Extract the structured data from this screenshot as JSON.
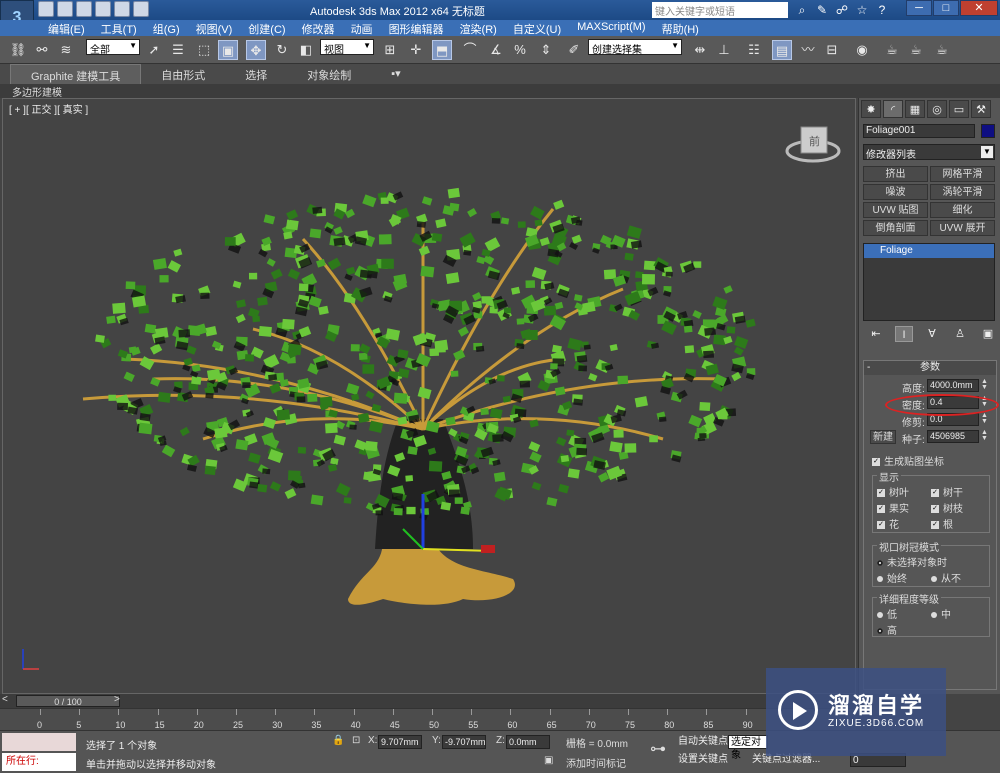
{
  "titlebar": {
    "title": "Autodesk 3ds Max  2012 x64      无标题",
    "search_placeholder": "键入关键字或短语",
    "minimize": "─",
    "maximize": "□",
    "close": "✕"
  },
  "menubar": [
    "编辑(E)",
    "工具(T)",
    "组(G)",
    "视图(V)",
    "创建(C)",
    "修改器",
    "动画",
    "图形编辑器",
    "渲染(R)",
    "自定义(U)",
    "MAXScript(M)",
    "帮助(H)"
  ],
  "toolbar": {
    "selection_filter": "全部",
    "ref_coord": "视图",
    "named_selection": "创建选择集"
  },
  "ribbon": {
    "tabs": [
      "Graphite 建模工具",
      "自由形式",
      "选择",
      "对象绘制"
    ],
    "active_tab": "Graphite 建模工具",
    "sub_label": "多边形建模"
  },
  "viewport": {
    "label": "[ + ][ 正交 ][ 真实 ]",
    "viewcube_label": "前"
  },
  "command_panel": {
    "object_name": "Foliage001",
    "object_color": "#0e0e82",
    "modifier_list": "修改器列表",
    "modifier_buttons": [
      "挤出",
      "网格平滑",
      "噪波",
      "涡轮平滑",
      "UVW 贴图",
      "细化",
      "倒角剖面",
      "UVW 展开"
    ],
    "stack_item": "Foliage",
    "params_title": "参数",
    "height_label": "高度:",
    "height_value": "4000.0mm",
    "density_label": "密度:",
    "density_value": "0.4",
    "prune_label": "修剪:",
    "prune_value": "0.0",
    "new_label": "新建",
    "seed_label": "种子:",
    "seed_value": "4506985",
    "gen_mapping": "生成贴图坐标",
    "display_title": "显示",
    "display_items": [
      "树叶",
      "树干",
      "果实",
      "树枝",
      "花",
      "根"
    ],
    "canopy_title": "视口树冠模式",
    "canopy_options": [
      "未选择对象时",
      "始终",
      "从不"
    ],
    "lod_title": "详细程度等级",
    "lod_options": [
      "低",
      "中",
      "高"
    ]
  },
  "timeline": {
    "slider": "0 / 100",
    "ticks": [
      "0",
      "5",
      "10",
      "15",
      "20",
      "25",
      "30",
      "35",
      "40",
      "45",
      "50",
      "55",
      "60",
      "65",
      "70",
      "75",
      "80",
      "85",
      "90"
    ]
  },
  "status": {
    "maxscript_label": "所在行:",
    "selected_text": "选择了 1 个对象",
    "prompt_text": "单击并拖动以选择并移动对象",
    "x_label": "X:",
    "x_value": "9.707mm",
    "y_label": "Y:",
    "y_value": "-9.707mm",
    "z_label": "Z:",
    "z_value": "0.0mm",
    "grid": "栅格 = 0.0mm",
    "add_time_tag": "添加时间标记",
    "auto_key": "自动关键点",
    "auto_key_select": "选定对象",
    "set_key": "设置关键点",
    "key_filter": "关键点过滤器...",
    "frame_value": "0"
  },
  "watermark": {
    "title": "溜溜自学",
    "url": "ZIXUE.3D66.COM"
  },
  "colors": {
    "highlight": "#dd2222",
    "leaf": "#4aa82a",
    "trunk": "#c79a3a"
  }
}
